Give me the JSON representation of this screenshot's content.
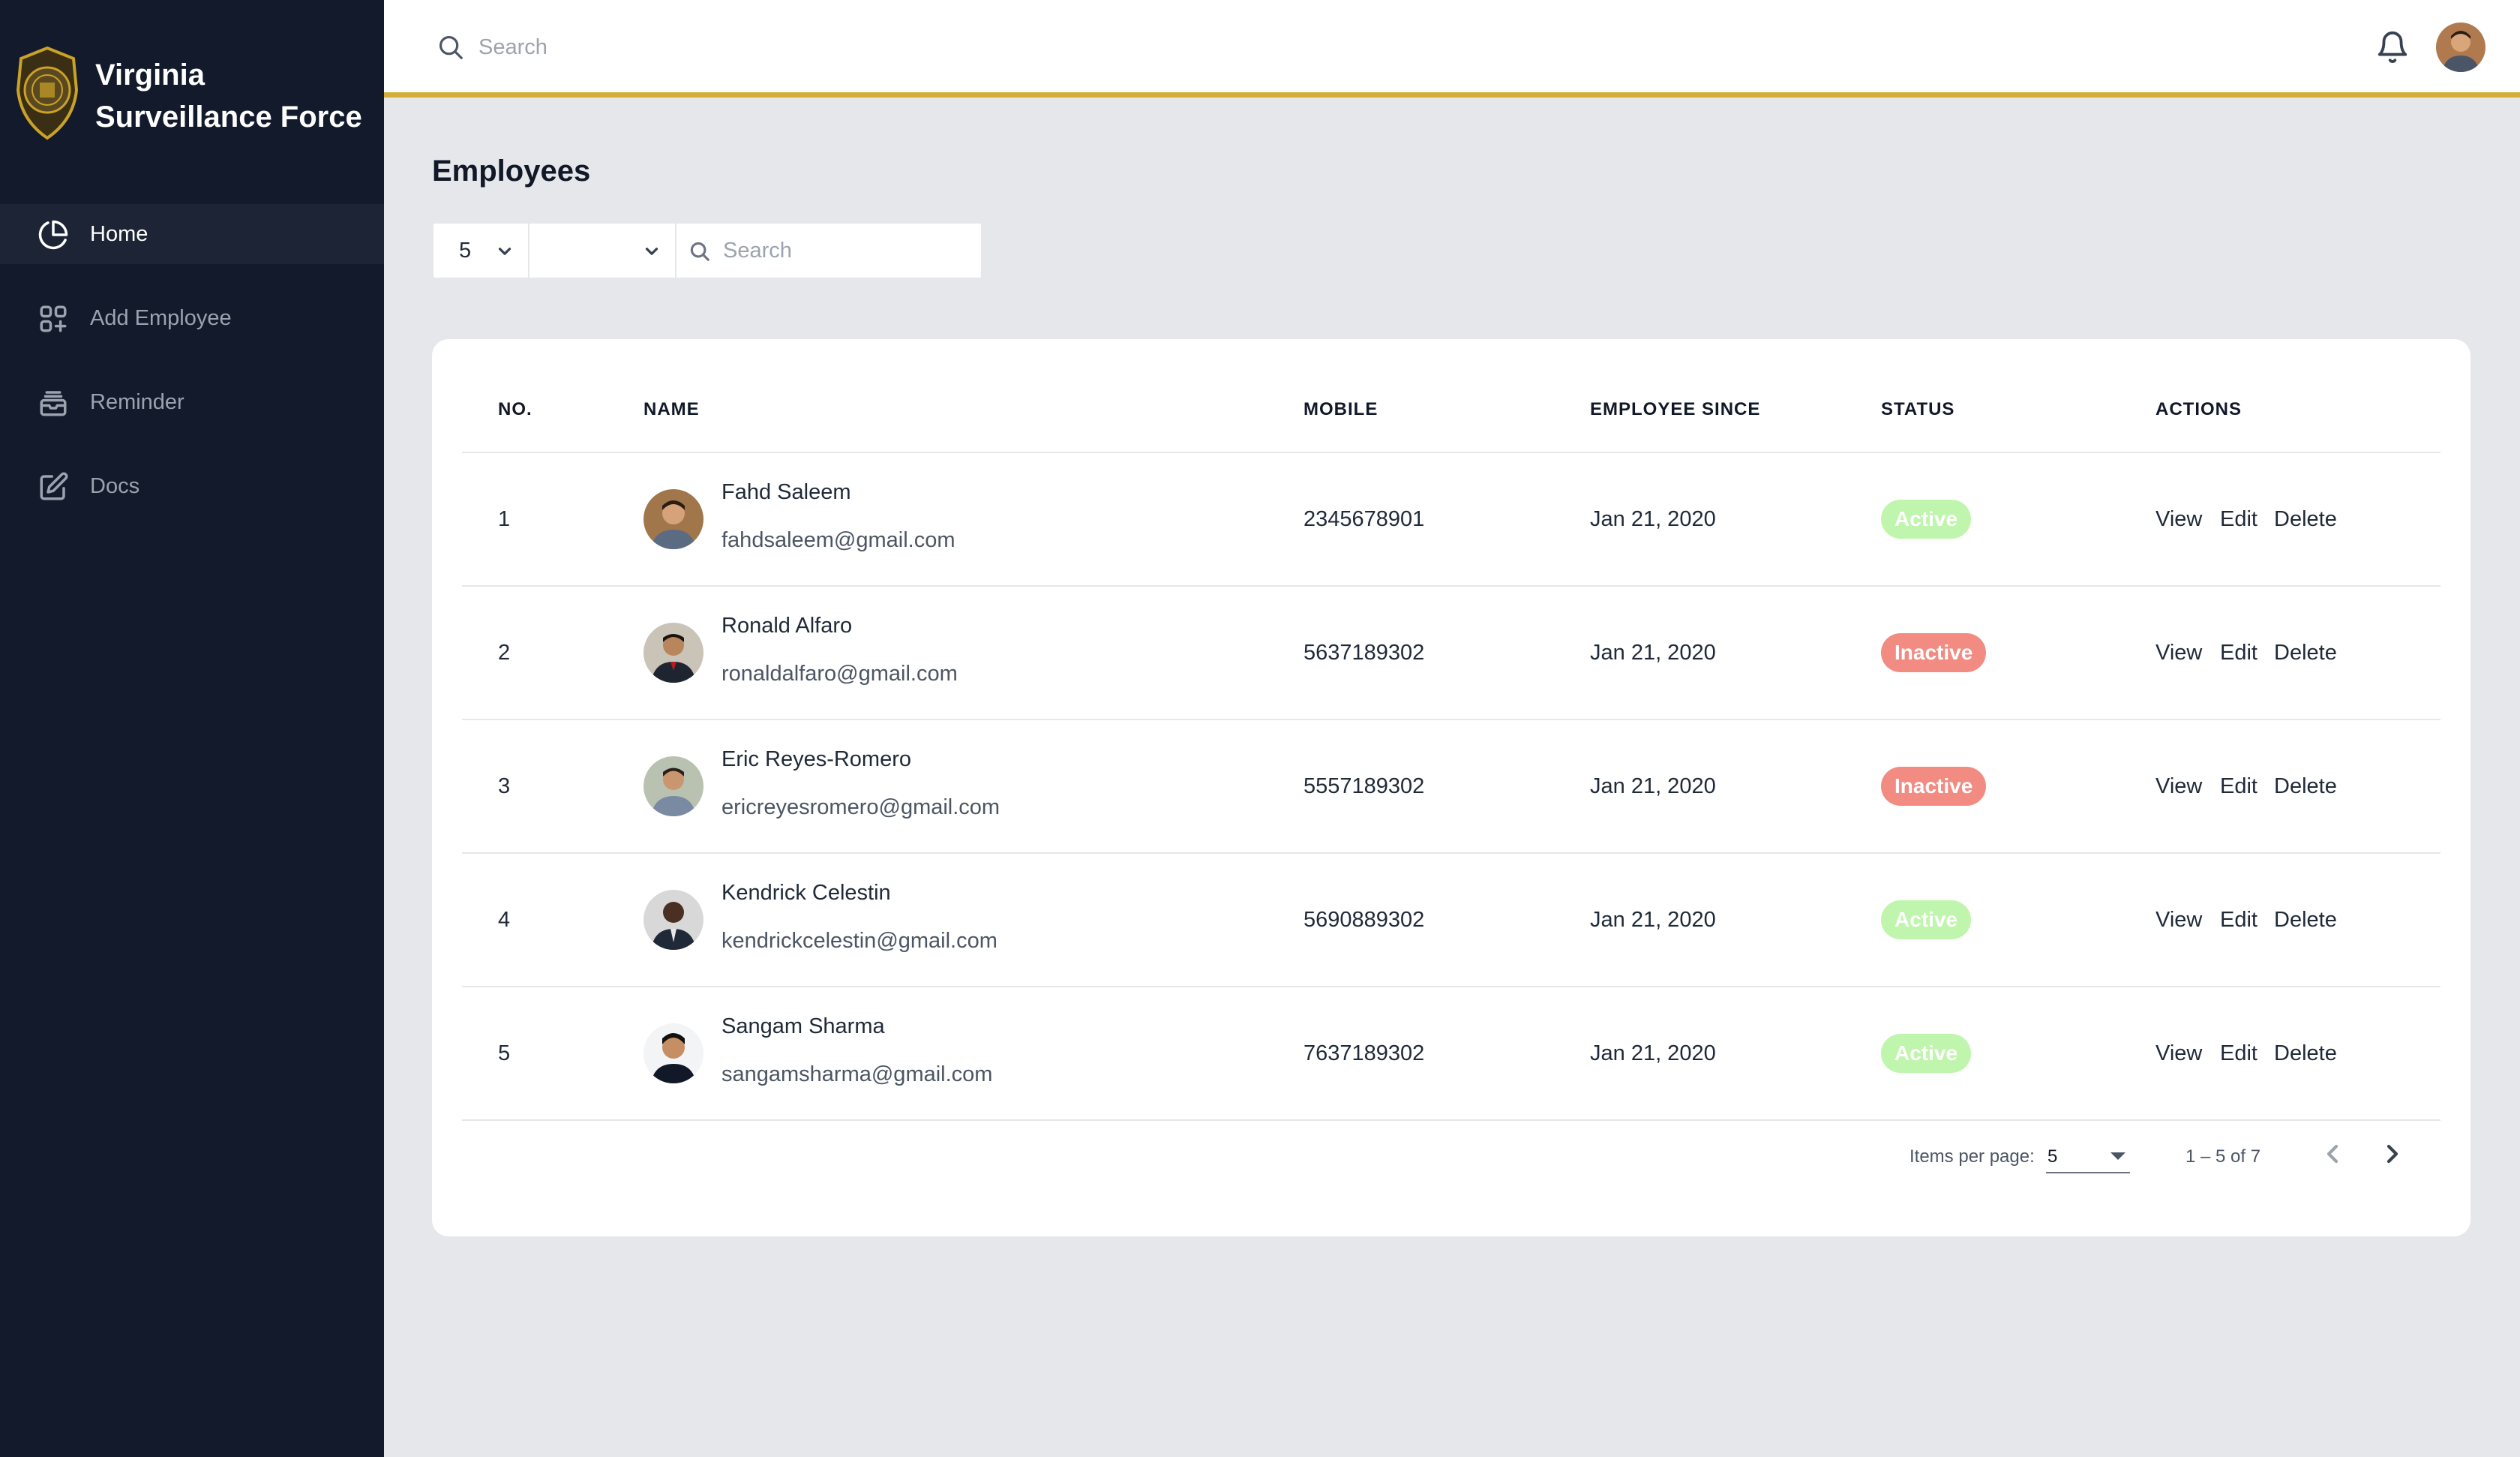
{
  "brand": {
    "title": "Virginia Surveillance Force"
  },
  "sidebar": {
    "items": [
      {
        "label": "Home",
        "icon": "pie-chart-icon",
        "active": true
      },
      {
        "label": "Add Employee",
        "icon": "grid-plus-icon",
        "active": false
      },
      {
        "label": "Reminder",
        "icon": "archive-icon",
        "active": false
      },
      {
        "label": "Docs",
        "icon": "edit-document-icon",
        "active": false
      }
    ]
  },
  "topbar": {
    "search_placeholder": "Search"
  },
  "page": {
    "title": "Employees"
  },
  "filters": {
    "page_size": "5",
    "status": "",
    "search_placeholder": "Search"
  },
  "table": {
    "headers": {
      "no": "NO.",
      "name": "NAME",
      "mobile": "MOBILE",
      "since": "EMPLOYEE SINCE",
      "status": "STATUS",
      "actions": "ACTIONS"
    },
    "actions": {
      "view": "View",
      "edit": "Edit",
      "delete": "Delete"
    },
    "rows": [
      {
        "no": "1",
        "name": "Fahd Saleem",
        "email": "fahdsaleem@gmail.com",
        "mobile": "2345678901",
        "since": "Jan 21, 2020",
        "status": "Active"
      },
      {
        "no": "2",
        "name": "Ronald Alfaro",
        "email": "ronaldalfaro@gmail.com",
        "mobile": "5637189302",
        "since": "Jan 21, 2020",
        "status": "Inactive"
      },
      {
        "no": "3",
        "name": "Eric Reyes-Romero",
        "email": "ericreyesromero@gmail.com",
        "mobile": "5557189302",
        "since": "Jan 21, 2020",
        "status": "Inactive"
      },
      {
        "no": "4",
        "name": "Kendrick Celestin",
        "email": "kendrickcelestin@gmail.com",
        "mobile": "5690889302",
        "since": "Jan 21, 2020",
        "status": "Active"
      },
      {
        "no": "5",
        "name": "Sangam Sharma",
        "email": "sangamsharma@gmail.com",
        "mobile": "7637189302",
        "since": "Jan 21, 2020",
        "status": "Active"
      }
    ]
  },
  "pagination": {
    "items_per_page_label": "Items per page:",
    "items_per_page": "5",
    "range": "1 – 5 of 7"
  },
  "colors": {
    "sidebar_bg": "#121a2b",
    "accent": "#d4af37",
    "active_badge": "#c0f5ae",
    "inactive_badge": "#f28b82"
  }
}
